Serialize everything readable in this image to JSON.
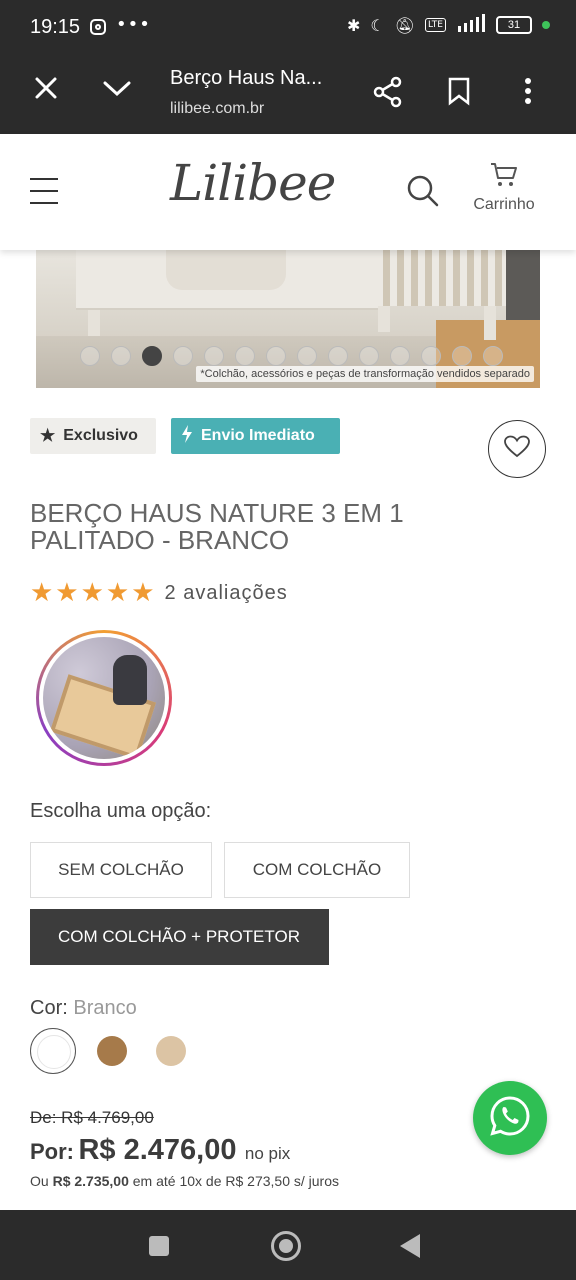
{
  "status_bar": {
    "time": "19:15",
    "dots": "•••",
    "battery": "31"
  },
  "browser": {
    "title": "Berço Haus Na...",
    "url": "lilibee.com.br"
  },
  "site": {
    "logo": "Lilibee",
    "cart_label": "Carrinho"
  },
  "product_image": {
    "note": "*Colchão, acessórios e peças de transformação vendidos separado",
    "carousel_total": 14,
    "carousel_active": 3
  },
  "badges": {
    "exclusive": "Exclusivo",
    "shipping": "Envio Imediato"
  },
  "product": {
    "title": "BERÇO HAUS NATURE 3 EM 1 PALITADO - BRANCO",
    "stars": "★★★★★",
    "rating": 5,
    "reviews": "2 avaliações"
  },
  "options": {
    "label": "Escolha uma opção:",
    "items": [
      "SEM COLCHÃO",
      "COM COLCHÃO",
      "COM COLCHÃO + PROTETOR"
    ],
    "selected": "COM COLCHÃO + PROTETOR"
  },
  "color": {
    "label": "Cor:",
    "value": "Branco",
    "swatches": [
      "#ffffff",
      "#a67a4a",
      "#dcc4a4"
    ]
  },
  "price": {
    "old": "De: R$ 4.769,00",
    "por_label": "Por:",
    "amount": "R$ 2.476,00",
    "pix": "no pix",
    "inst_prefix": "Ou",
    "inst_total": "R$ 2.735,00",
    "inst_rest": "em até 10x de R$ 273,50 s/ juros"
  },
  "colors": {
    "badge_teal": "#4ab0b4",
    "star_orange": "#f09a32",
    "whatsapp_green": "#2fbf54",
    "selected_option": "#3c3c3c"
  }
}
